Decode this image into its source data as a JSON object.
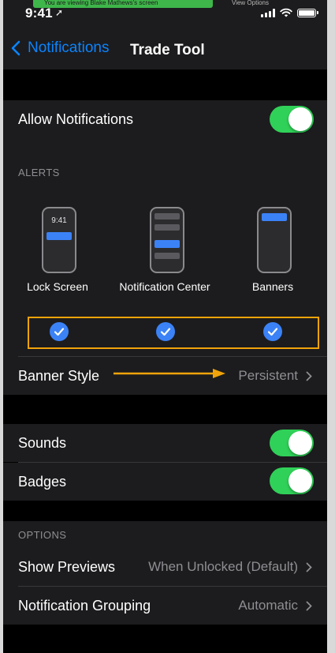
{
  "screen_share": {
    "banner_text": "You are viewing Blake Mathews's screen",
    "view_options": "View Options"
  },
  "status_bar": {
    "time": "9:41",
    "location_icon": "location-arrow-icon",
    "signal_icon": "cellular-signal-icon",
    "wifi_icon": "wifi-icon",
    "battery_icon": "battery-icon"
  },
  "nav": {
    "back_label": "Notifications",
    "title": "Trade Tool"
  },
  "allow_notifications": {
    "label": "Allow Notifications",
    "enabled": true
  },
  "alerts": {
    "header": "ALERTS",
    "lock_screen_time": "9:41",
    "styles": [
      {
        "label": "Lock Screen",
        "checked": true
      },
      {
        "label": "Notification Center",
        "checked": true
      },
      {
        "label": "Banners",
        "checked": true
      }
    ],
    "banner_style": {
      "label": "Banner Style",
      "value": "Persistent"
    }
  },
  "sounds": {
    "label": "Sounds",
    "enabled": true
  },
  "badges": {
    "label": "Badges",
    "enabled": true
  },
  "options": {
    "header": "OPTIONS",
    "show_previews": {
      "label": "Show Previews",
      "value": "When Unlocked (Default)"
    },
    "notification_grouping": {
      "label": "Notification Grouping",
      "value": "Automatic"
    }
  },
  "colors": {
    "accent": "#0a84ff",
    "toggle_on": "#30d158",
    "check_blue": "#3b82f6",
    "annotation": "#f0a30a",
    "cell_bg": "#1c1c1e"
  }
}
